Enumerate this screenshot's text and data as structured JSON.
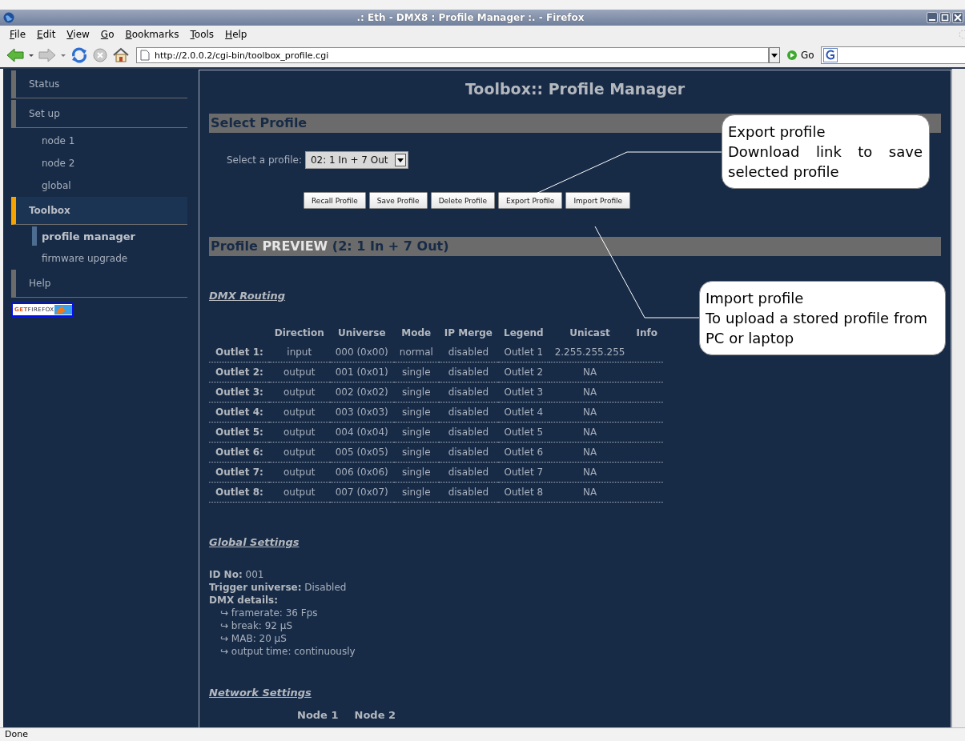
{
  "window": {
    "title": ".: Eth - DMX8 : Profile Manager :. - Firefox"
  },
  "menu": [
    "File",
    "Edit",
    "View",
    "Go",
    "Bookmarks",
    "Tools",
    "Help"
  ],
  "toolbar": {
    "url": "http://2.0.0.2/cgi-bin/toolbox_profile.cgi",
    "go": "Go"
  },
  "sidebar": {
    "items": [
      {
        "label": "Status",
        "selected": false
      },
      {
        "label": "Set up",
        "selected": false,
        "children": [
          {
            "label": "node 1",
            "selected": false
          },
          {
            "label": "node 2",
            "selected": false
          },
          {
            "label": "global",
            "selected": false
          }
        ]
      },
      {
        "label": "Toolbox",
        "selected": true,
        "children": [
          {
            "label": "profile manager",
            "selected": true
          },
          {
            "label": "firmware upgrade",
            "selected": false
          }
        ]
      },
      {
        "label": "Help",
        "selected": false
      }
    ],
    "badge": "**GET**FIREFOX"
  },
  "page": {
    "title": "Toolbox:: Profile Manager",
    "select_profile": {
      "heading": "Select Profile",
      "label": "Select a profile:",
      "value": "02: 1 In + 7 Out",
      "buttons": [
        "Recall Profile",
        "Save Profile",
        "Delete Profile",
        "Export Profile",
        "Import Profile"
      ]
    },
    "preview": {
      "heading": "Profile **PREVIEW** (2: 1 In + 7 Out)",
      "routing": {
        "heading": "DMX Routing",
        "columns": [
          "Direction",
          "Universe",
          "Mode",
          "IP Merge",
          "Legend",
          "Unicast",
          "Info"
        ],
        "rows": [
          {
            "label": "Outlet 1:",
            "cells": [
              "input",
              "000 (0x00)",
              "normal",
              "disabled",
              "Outlet 1",
              "2.255.255.255"
            ]
          },
          {
            "label": "Outlet 2:",
            "cells": [
              "output",
              "001 (0x01)",
              "single",
              "disabled",
              "Outlet 2",
              "NA"
            ]
          },
          {
            "label": "Outlet 3:",
            "cells": [
              "output",
              "002 (0x02)",
              "single",
              "disabled",
              "Outlet 3",
              "NA"
            ]
          },
          {
            "label": "Outlet 4:",
            "cells": [
              "output",
              "003 (0x03)",
              "single",
              "disabled",
              "Outlet 4",
              "NA"
            ]
          },
          {
            "label": "Outlet 5:",
            "cells": [
              "output",
              "004 (0x04)",
              "single",
              "disabled",
              "Outlet 5",
              "NA"
            ]
          },
          {
            "label": "Outlet 6:",
            "cells": [
              "output",
              "005 (0x05)",
              "single",
              "disabled",
              "Outlet 6",
              "NA"
            ]
          },
          {
            "label": "Outlet 7:",
            "cells": [
              "output",
              "006 (0x06)",
              "single",
              "disabled",
              "Outlet 7",
              "NA"
            ]
          },
          {
            "label": "Outlet 8:",
            "cells": [
              "output",
              "007 (0x07)",
              "single",
              "disabled",
              "Outlet 8",
              "NA"
            ]
          }
        ]
      },
      "global": {
        "heading": "Global Settings",
        "lines": [
          "**ID No:** 001",
          "**Trigger universe:** Disabled",
          "**DMX details:**"
        ],
        "details": [
          "↪ framerate: 36 Fps",
          "↪ break: 92 µS",
          "↪ MAB: 20 µS",
          "↪ output time: continuously"
        ]
      },
      "network": {
        "heading": "Network Settings",
        "columns": [
          "Node 1",
          "Node 2"
        ]
      }
    }
  },
  "callouts": [
    {
      "title": "Export profile",
      "text": "Download link to save selected profile"
    },
    {
      "title": "Import profile",
      "text": "To upload a stored profile from PC or laptop"
    }
  ],
  "status_bar": "Done"
}
